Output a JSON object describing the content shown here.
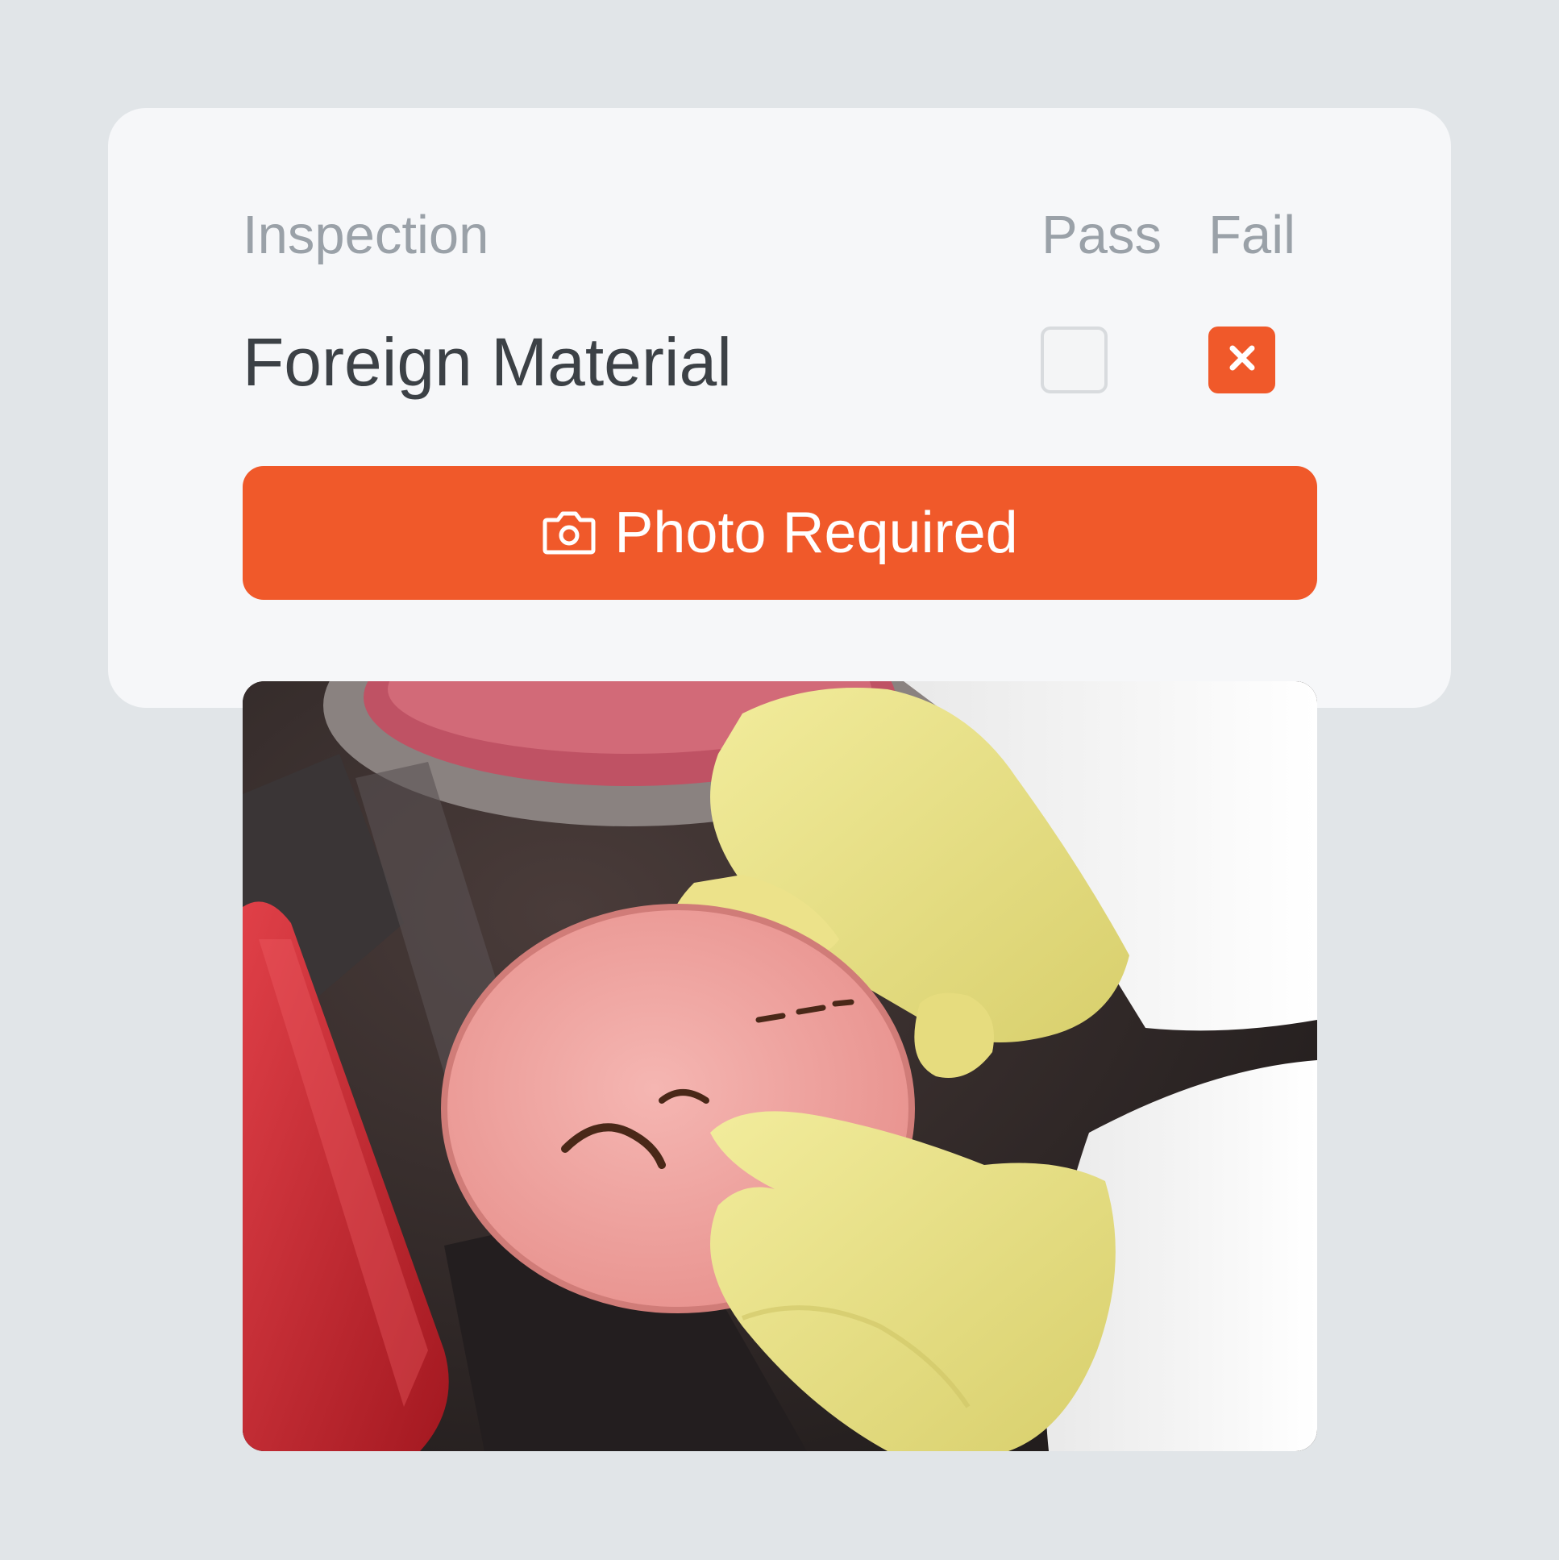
{
  "inspection": {
    "column_header": "Inspection",
    "pass_header": "Pass",
    "fail_header": "Fail",
    "item": {
      "label": "Foreign Material",
      "pass_checked": false,
      "fail_checked": true
    },
    "photo_button": {
      "label": "Photo Required",
      "icon": "camera-icon"
    },
    "photo": {
      "alt": "foreign-material-photo"
    }
  },
  "colors": {
    "background": "#e1e5e8",
    "card": "#f6f7f9",
    "accent": "#f0592a",
    "header_text": "#9aa1a8",
    "label_text": "#3c4146"
  }
}
